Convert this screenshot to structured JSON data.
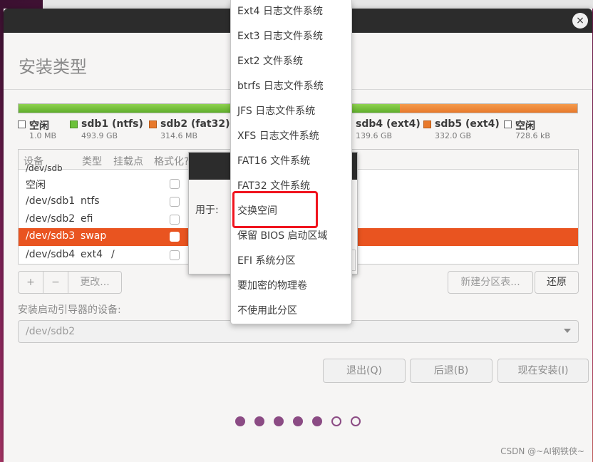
{
  "page": {
    "title": "安装类型"
  },
  "titlebar": {
    "close_icon": "close-icon",
    "close_glyph": "×"
  },
  "partition_bar": {
    "colors": {
      "green": "#6cc13a",
      "orange": "#e8792b"
    }
  },
  "legend": [
    {
      "name": "空闲",
      "size": "1.0 MB",
      "kind": "empty"
    },
    {
      "name": "sdb1 (ntfs)",
      "size": "493.9 GB",
      "kind": "green"
    },
    {
      "name": "sdb2 (fat32)",
      "size": "314.6 MB",
      "kind": "orange"
    },
    {
      "name": "sdb4 (ext4)",
      "size": "139.6 GB",
      "kind": "green"
    },
    {
      "name": "sdb5 (ext4)",
      "size": "332.0 GB",
      "kind": "orange"
    },
    {
      "name": "空闲",
      "size": "728.6 kB",
      "kind": "empty"
    }
  ],
  "table": {
    "headers": [
      "设备",
      "类型",
      "挂载点",
      "格式化?"
    ],
    "cut_row": "/dev/sdb",
    "rows": [
      {
        "device": "空闲",
        "type": "",
        "mount": "",
        "selected": false
      },
      {
        "device": "/dev/sdb1",
        "type": "ntfs",
        "mount": "",
        "selected": false
      },
      {
        "device": "/dev/sdb2",
        "type": "efi",
        "mount": "",
        "selected": false
      },
      {
        "device": "/dev/sdb3",
        "type": "swap",
        "mount": "",
        "selected": true
      },
      {
        "device": "/dev/sdb4",
        "type": "ext4",
        "mount": "/",
        "selected": false
      }
    ]
  },
  "toolbar": {
    "add_label": "+",
    "remove_label": "−",
    "change_label": "更改...",
    "new_table_label": "新建分区表...",
    "revert_label": "还原"
  },
  "boot": {
    "label": "安装启动引导器的设备:",
    "value": "/dev/sdb2"
  },
  "actions": {
    "quit_label": "退出(Q)",
    "back_label": "后退(B)",
    "install_label": "现在安装(I)"
  },
  "progress_dots": {
    "total": 7,
    "filled": 5
  },
  "dialog": {
    "use_as_label": "用于:"
  },
  "dropdown": {
    "items": [
      "Ext4 日志文件系统",
      "Ext3 日志文件系统",
      "Ext2 文件系统",
      "btrfs 日志文件系统",
      "JFS 日志文件系统",
      "XFS 日志文件系统",
      "FAT16 文件系统",
      "FAT32 文件系统",
      "交换空间",
      "保留 BIOS 启动区域",
      "EFI 系统分区",
      "要加密的物理卷",
      "不使用此分区"
    ],
    "highlighted_index": 8,
    "highlight_color": "#f0141e"
  },
  "watermark": "CSDN @~AI钢铁侠~"
}
